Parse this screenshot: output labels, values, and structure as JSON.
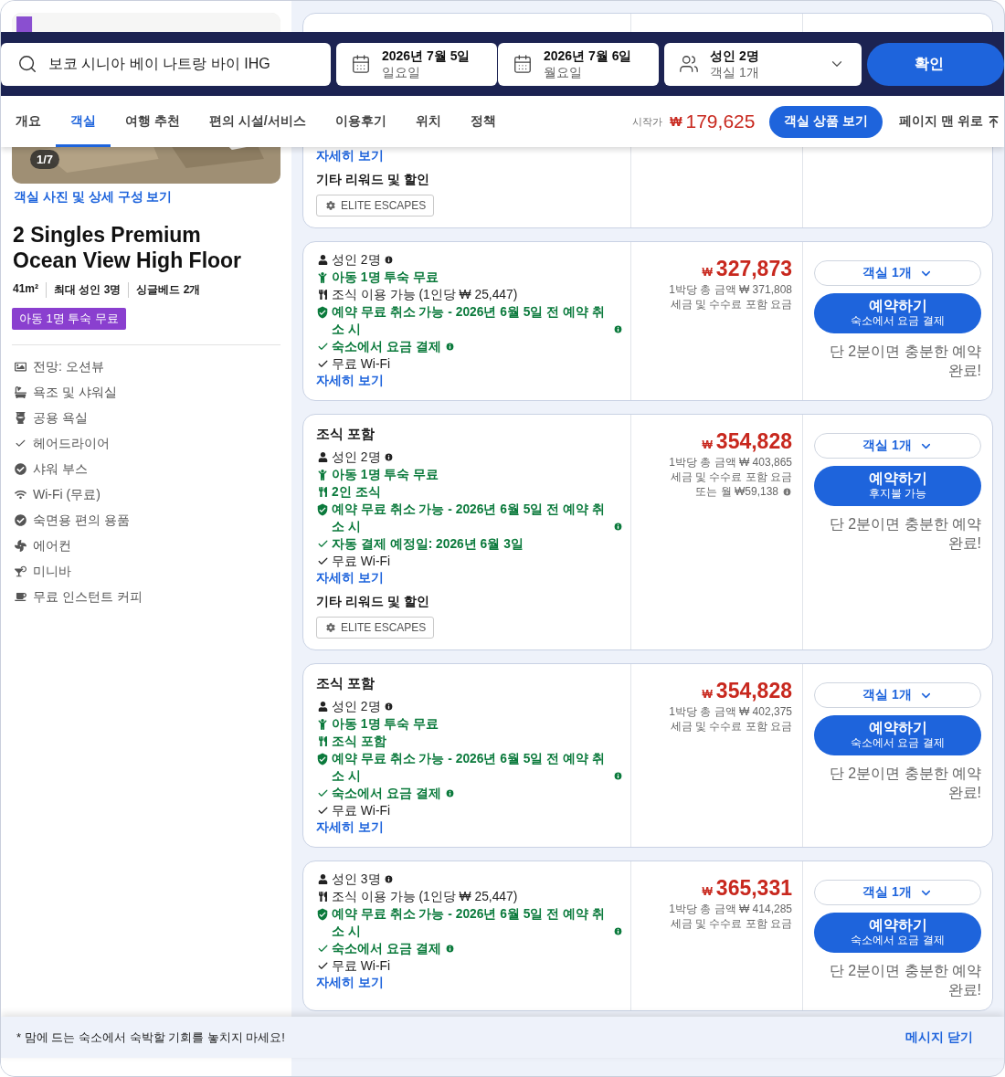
{
  "search": {
    "destination": "보코 시니아 베이 나트랑 바이 IHG",
    "check_in": {
      "date": "2026년 7월 5일",
      "weekday": "일요일"
    },
    "check_out": {
      "date": "2026년 7월 6일",
      "weekday": "월요일"
    },
    "guests": {
      "people": "성인 2명",
      "rooms": "객실 1개"
    },
    "confirm_button": "확인"
  },
  "tabs": [
    {
      "label": "개요",
      "selected": false
    },
    {
      "label": "객실",
      "selected": true
    },
    {
      "label": "여행 추천",
      "selected": false
    },
    {
      "label": "편의 시설/서비스",
      "selected": false
    },
    {
      "label": "이용후기",
      "selected": false
    },
    {
      "label": "위치",
      "selected": false
    },
    {
      "label": "정책",
      "selected": false
    }
  ],
  "price_summary": {
    "label": "시작가",
    "currency": "₩",
    "amount": "179,625",
    "button": "객실 상품 보기",
    "back_to_top": "페이지 맨 위로"
  },
  "room": {
    "photo_counter": "1/7",
    "photo_link": "객실 사진 및 상세 구성 보기",
    "name": "2 Singles Premium Ocean View High Floor",
    "specs": [
      "41m²",
      "최대 성인 3명",
      "싱글베드 2개"
    ],
    "badge": "아동 1명 투숙 무료",
    "amenities": [
      {
        "kind": "view",
        "label": "전망: 오션뷰"
      },
      {
        "kind": "bath",
        "label": "욕조 및 샤워실"
      },
      {
        "kind": "toilet",
        "label": "공용 욕실"
      },
      {
        "kind": "check",
        "label": "헤어드라이어"
      },
      {
        "kind": "check-circle",
        "label": "샤워 부스"
      },
      {
        "kind": "wifi",
        "label": "Wi-Fi (무료)"
      },
      {
        "kind": "check-circle",
        "label": "숙면용 편의 용품"
      },
      {
        "kind": "fan",
        "label": "에어컨"
      },
      {
        "kind": "cocktail",
        "label": "미니바"
      },
      {
        "kind": "coffee",
        "label": "무료 인스턴트 커피"
      }
    ]
  },
  "offers": [
    {
      "top_hidden": true,
      "details_link": "자세히 보기",
      "rewards": {
        "heading": "기타 리워드 및 할인",
        "tags": [
          "ELITE ESCAPES"
        ]
      }
    },
    {
      "top_hidden": false,
      "features": [
        {
          "kind": "adults",
          "text": "성인 2명",
          "positive": false,
          "info": true
        },
        {
          "kind": "child",
          "text": "아동 1명 투숙 무료",
          "positive": true,
          "info": false
        },
        {
          "kind": "meal",
          "text": "조식 이용 가능 (1인당 ₩ 25,447)",
          "positive": false,
          "info": false
        },
        {
          "kind": "cancel",
          "text": "예약 무료 취소 가능 - 2026년 6월 5일 전 예약 취소 시",
          "positive": true,
          "info": true
        },
        {
          "kind": "check",
          "text": "숙소에서 요금 결제",
          "positive": true,
          "info": true
        },
        {
          "kind": "check",
          "text": "무료 Wi-Fi",
          "positive": false,
          "info": false
        }
      ],
      "details_link": "자세히 보기",
      "price": {
        "currency": "₩",
        "amount": "327,873",
        "total": "1박당 총 금액 ₩ 371,808",
        "note": "세금 및 수수료 포함 요금"
      },
      "room_select": "객실 1개",
      "book": {
        "label": "예약하기",
        "sub": "숙소에서 요금 결제"
      },
      "hint": "단 2분이면 충분한 예약 완료!"
    },
    {
      "top_hidden": false,
      "title": "조식 포함",
      "features": [
        {
          "kind": "adults",
          "text": "성인 2명",
          "positive": false,
          "info": true
        },
        {
          "kind": "child",
          "text": "아동 1명 투숙 무료",
          "positive": true,
          "info": false
        },
        {
          "kind": "meal",
          "text": "2인 조식",
          "positive": true,
          "info": false
        },
        {
          "kind": "cancel",
          "text": "예약 무료 취소 가능 - 2026년 6월 5일 전 예약 취소 시",
          "positive": true,
          "info": true
        },
        {
          "kind": "check",
          "text": "자동 결제 예정일: 2026년 6월 3일",
          "positive": true,
          "info": false
        },
        {
          "kind": "check",
          "text": "무료 Wi-Fi",
          "positive": false,
          "info": false
        }
      ],
      "details_link": "자세히 보기",
      "rewards": {
        "heading": "기타 리워드 및 할인",
        "tags": [
          "ELITE ESCAPES"
        ]
      },
      "price": {
        "currency": "₩",
        "amount": "354,828",
        "total": "1박당 총 금액 ₩ 403,865",
        "note": "세금 및 수수료 포함 요금",
        "monthly": "또는 월 ₩59,138"
      },
      "room_select": "객실 1개",
      "book": {
        "label": "예약하기",
        "sub": "후지불 가능"
      },
      "hint": "단 2분이면 충분한 예약 완료!"
    },
    {
      "top_hidden": false,
      "title": "조식 포함",
      "features": [
        {
          "kind": "adults",
          "text": "성인 2명",
          "positive": false,
          "info": true
        },
        {
          "kind": "child",
          "text": "아동 1명 투숙 무료",
          "positive": true,
          "info": false
        },
        {
          "kind": "meal",
          "text": "조식 포함",
          "positive": true,
          "info": false
        },
        {
          "kind": "cancel",
          "text": "예약 무료 취소 가능 - 2026년 6월 5일 전 예약 취소 시",
          "positive": true,
          "info": true
        },
        {
          "kind": "check",
          "text": "숙소에서 요금 결제",
          "positive": true,
          "info": true
        },
        {
          "kind": "check",
          "text": "무료 Wi-Fi",
          "positive": false,
          "info": false
        }
      ],
      "details_link": "자세히 보기",
      "price": {
        "currency": "₩",
        "amount": "354,828",
        "total": "1박당 총 금액 ₩ 402,375",
        "note": "세금 및 수수료 포함 요금"
      },
      "room_select": "객실 1개",
      "book": {
        "label": "예약하기",
        "sub": "숙소에서 요금 결제"
      },
      "hint": "단 2분이면 충분한 예약 완료!"
    },
    {
      "top_hidden": false,
      "features": [
        {
          "kind": "adults",
          "text": "성인 3명",
          "positive": false,
          "info": true
        },
        {
          "kind": "meal",
          "text": "조식 이용 가능 (1인당 ₩ 25,447)",
          "positive": false,
          "info": false
        },
        {
          "kind": "cancel",
          "text": "예약 무료 취소 가능 - 2026년 6월 5일 전 예약 취소 시",
          "positive": true,
          "info": true
        },
        {
          "kind": "check",
          "text": "숙소에서 요금 결제",
          "positive": true,
          "info": true
        },
        {
          "kind": "check",
          "text": "무료 Wi-Fi",
          "positive": false,
          "info": false
        }
      ],
      "details_link": "자세히 보기",
      "price": {
        "currency": "₩",
        "amount": "365,331",
        "total": "1박당 총 금액 ₩ 414,285",
        "note": "세금 및 수수료 포함 요금"
      },
      "room_select": "객실 1개",
      "book": {
        "label": "예약하기",
        "sub": "숙소에서 요금 결제"
      },
      "hint": "단 2분이면 충분한 예약 완료!"
    }
  ],
  "message": {
    "text": "* 맘에 드는 숙소에서 숙박할 기회를 놓치지 마세요!",
    "close": "메시지 닫기"
  }
}
